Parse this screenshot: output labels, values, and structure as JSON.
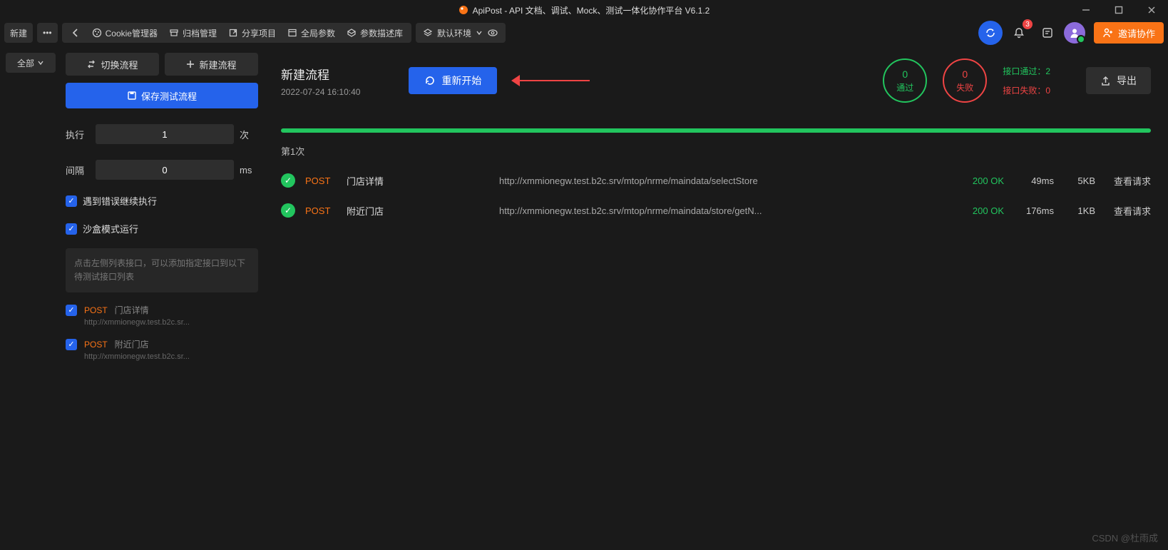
{
  "window": {
    "title": "ApiPost - API 文档、调试、Mock、测试一体化协作平台 V6.1.2"
  },
  "toolbar": {
    "new_btn": "新建",
    "back_aria": "返回",
    "cookie": "Cookie管理器",
    "archive": "归档管理",
    "share": "分享项目",
    "globals": "全局参数",
    "params_lib": "参数描述库",
    "env": "默认环境",
    "notif_badge": "3",
    "invite": "邀请协作"
  },
  "sidebarA": {
    "filter": "全部"
  },
  "sidebarB": {
    "switch_btn": "切换流程",
    "new_btn": "新建流程",
    "save_btn": "保存测试流程",
    "exec_label": "执行",
    "exec_value": "1",
    "exec_unit": "次",
    "interval_label": "间隔",
    "interval_value": "0",
    "interval_unit": "ms",
    "cb1": "遇到错误继续执行",
    "cb2": "沙盒模式运行",
    "hint": "点击左侧列表接口，可以添加指定接口到以下待测试接口列表",
    "apis": [
      {
        "method": "POST",
        "name": "门店详情",
        "url": "http://xmmionegw.test.b2c.sr..."
      },
      {
        "method": "POST",
        "name": "附近门店",
        "url": "http://xmmionegw.test.b2c.sr..."
      }
    ]
  },
  "main": {
    "title": "新建流程",
    "subtitle": "2022-07-24 16:10:40",
    "restart": "重新开始",
    "pass_count": "0",
    "pass_label": "通过",
    "fail_count": "0",
    "fail_label": "失败",
    "api_pass": "接口通过：2",
    "api_fail": "接口失败：0",
    "export": "导出",
    "run_label": "第1次",
    "results": [
      {
        "method": "POST",
        "name": "门店详情",
        "url": "http://xmmionegw.test.b2c.srv/mtop/nrme/maindata/selectStore",
        "status": "200 OK",
        "time": "49ms",
        "size": "5KB",
        "view": "查看请求"
      },
      {
        "method": "POST",
        "name": "附近门店",
        "url": "http://xmmionegw.test.b2c.srv/mtop/nrme/maindata/store/getN...",
        "status": "200 OK",
        "time": "176ms",
        "size": "1KB",
        "view": "查看请求"
      }
    ]
  },
  "watermark": "CSDN @杜雨成"
}
